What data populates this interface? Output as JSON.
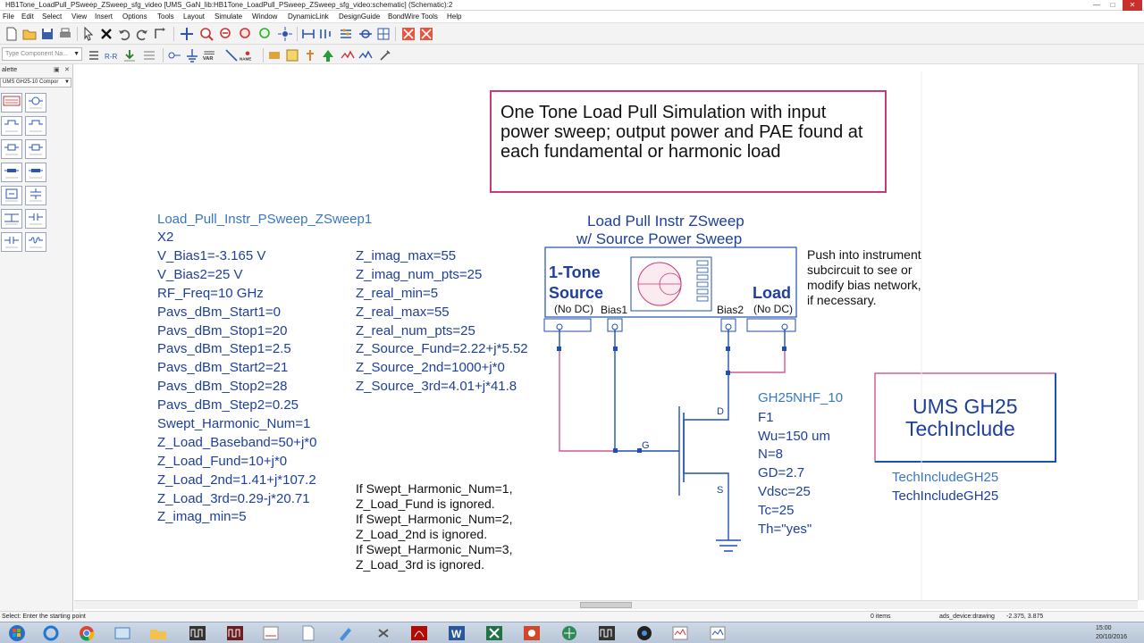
{
  "window": {
    "title": "HB1Tone_LoadPull_PSweep_ZSweep_sfg_video [UMS_GaN_lib:HB1Tone_LoadPull_PSweep_ZSweep_sfg_video:schematic] (Schematic):2",
    "controls": [
      "—",
      "□",
      "✕"
    ]
  },
  "menu": [
    "File",
    "Edit",
    "Select",
    "View",
    "Insert",
    "Options",
    "Tools",
    "Layout",
    "Simulate",
    "Window",
    "DynamicLink",
    "DesignGuide",
    "BondWire Tools",
    "Help"
  ],
  "toolbar": {
    "component_search_placeholder": "Type Component Na...",
    "icons_row1": [
      "new-icon",
      "open-icon",
      "save-icon",
      "print-icon",
      "select-icon",
      "delete-icon",
      "undo-icon",
      "redo-icon",
      "rotate-icon",
      "move-icon",
      "zoom-icon",
      "simulate-icon",
      "tune-icon",
      "optimize-icon",
      "wire-icon",
      "pin-icon",
      "ground-icon"
    ],
    "icons_row2": [
      "wire-label-icon",
      "ground-icon",
      "var-icon",
      "line-icon",
      "name-icon",
      "push-icon",
      "pop-icon",
      "simulate-icon"
    ],
    "labels_row2": [
      "VAR",
      "NAME"
    ]
  },
  "palette": {
    "title": "alette",
    "library": "UMS GH25-10 Compor",
    "items": [
      "TECHINCL",
      "GH25NHF",
      "GH25RPI",
      "GH25RFD",
      "GH25RES1",
      "GH25RES2",
      "GH25TL1",
      "GH25TL2",
      "GH25DC",
      "GH25LIMC",
      "GH25CHM",
      "GH25CUR",
      "GH25CAP",
      "GH25IND"
    ]
  },
  "canvas": {
    "note": "One Tone Load Pull Simulation with input power sweep; output power and PAE found at each fundamental or harmonic load",
    "instance_name": "Load_Pull_Instr_PSweep_ZSweep1",
    "params_left": [
      "X2",
      "V_Bias1=-3.165 V",
      "V_Bias2=25 V",
      "RF_Freq=10 GHz",
      "Pavs_dBm_Start1=0",
      "Pavs_dBm_Stop1=20",
      "Pavs_dBm_Step1=2.5",
      "Pavs_dBm_Start2=21",
      "Pavs_dBm_Stop2=28",
      "Pavs_dBm_Step2=0.25",
      "Swept_Harmonic_Num=1",
      "Z_Load_Baseband=50+j*0",
      "Z_Load_Fund=10+j*0",
      "Z_Load_2nd=1.41+j*107.2",
      "Z_Load_3rd=0.29-j*20.71",
      "Z_imag_min=5"
    ],
    "params_right": [
      "Z_imag_max=55",
      "Z_imag_num_pts=25",
      "Z_real_min=5",
      "Z_real_max=55",
      "Z_real_num_pts=25",
      "Z_Source_Fund=2.22+j*5.52",
      "Z_Source_2nd=1000+j*0",
      "Z_Source_3rd=4.01+j*41.8"
    ],
    "harmonic_note": [
      "If Swept_Harmonic_Num=1,",
      "Z_Load_Fund is ignored.",
      "If Swept_Harmonic_Num=2,",
      "Z_Load_2nd is ignored.",
      "If Swept_Harmonic_Num=3,",
      "Z_Load_3rd is ignored."
    ],
    "instrument": {
      "title_line1": "Load Pull Instr ZSweep",
      "title_line2": "w/ Source Power Sweep",
      "source_line1": "1-Tone",
      "source_line2": "Source",
      "load": "Load",
      "no_dc_left": "(No DC)",
      "no_dc_right": "(No DC)",
      "bias1": "Bias1",
      "bias2": "Bias2"
    },
    "push_note": [
      "Push into instrument",
      "subcircuit to see or",
      "modify bias network,",
      "if necessary."
    ],
    "transistor": {
      "name": "GH25NHF_10",
      "params": [
        "F1",
        "Wu=150 um",
        "N=8",
        "GD=2.7",
        "Vdsc=25",
        "Tc=25",
        "Th=\"yes\""
      ],
      "pin_d": "D",
      "pin_g": "G",
      "pin_s": "S"
    },
    "techinclude": {
      "line1": "UMS GH25",
      "line2": "TechInclude",
      "label1": "TechIncludeGH25",
      "label2": "TechIncludeGH25"
    }
  },
  "status": {
    "prompt": "Select: Enter the starting point",
    "items": "0 items",
    "context": "ads_device:drawing",
    "coords": "-2.375, 3.875"
  },
  "taskbar": {
    "apps": [
      "start-icon",
      "ie-icon",
      "chrome-icon",
      "explorer-icon",
      "folder-icon",
      "ads-icon",
      "ads-data-icon",
      "ads-icon",
      "ads-icon",
      "document-icon",
      "pencil-icon",
      "acrobat-icon",
      "word-icon",
      "excel-icon",
      "powerpoint-icon",
      "network-icon",
      "ads-icon",
      "webcam-icon",
      "ads-icon",
      "ads-icon"
    ],
    "time": "15:00",
    "date": "20/10/2016"
  },
  "colors": {
    "wire_blue": "#1f4fb0",
    "wire_pink": "#d2578e",
    "text_blue": "#3a76c2",
    "text_navy": "#1e3f9a",
    "note_border": "#c93a7a",
    "techinclude_border": "#c93a7a"
  }
}
